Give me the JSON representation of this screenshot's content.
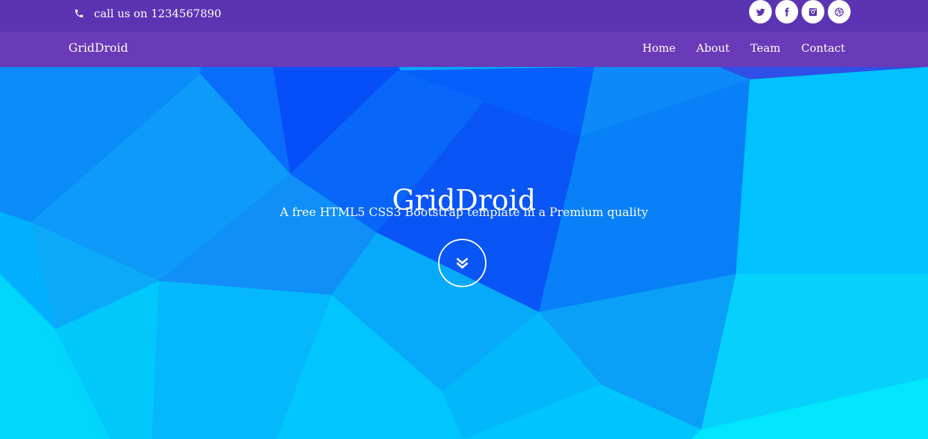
{
  "topbar": {
    "phone_text": "call us on 1234567890",
    "phone_icon": "phone-icon",
    "socials": [
      "twitter-icon",
      "facebook-icon",
      "instagram-icon",
      "dribbble-icon"
    ]
  },
  "navbar": {
    "brand": "GridDroid",
    "links": [
      "Home",
      "About",
      "Team",
      "Contact"
    ]
  },
  "hero": {
    "title": "GridDroid",
    "subtitle": "A free HTML5 CSS3 Bootstrap template in a Premium quality",
    "scroll_icon": "chevron-double-down-icon"
  },
  "colors": {
    "topbar": "#5c34b3",
    "navbar": "#6a3ab8",
    "hero_base": "#00aaff"
  }
}
